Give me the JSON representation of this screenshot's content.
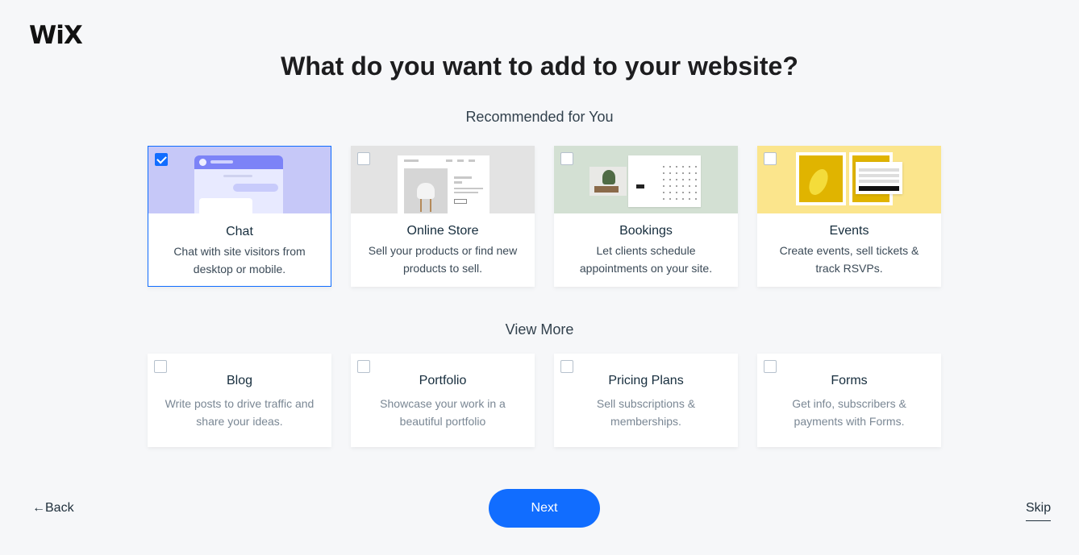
{
  "brand": {
    "logo_text": "WiX"
  },
  "title": "What do you want to add to your website?",
  "sections": {
    "recommended_label": "Recommended for You",
    "view_more_label": "View More"
  },
  "recommended": [
    {
      "title": "Chat",
      "description": "Chat with site visitors from desktop or mobile.",
      "checked": true
    },
    {
      "title": "Online Store",
      "description": "Sell your products or find new products to sell.",
      "checked": false
    },
    {
      "title": "Bookings",
      "description": "Let clients schedule appointments on your site.",
      "checked": false
    },
    {
      "title": "Events",
      "description": "Create events, sell tickets & track RSVPs.",
      "checked": false
    }
  ],
  "more": [
    {
      "title": "Blog",
      "description": "Write posts to drive traffic and share your ideas.",
      "checked": false
    },
    {
      "title": "Portfolio",
      "description": "Showcase your work in a beautiful portfolio",
      "checked": false
    },
    {
      "title": "Pricing Plans",
      "description": "Sell subscriptions & memberships.",
      "checked": false
    },
    {
      "title": "Forms",
      "description": "Get info, subscribers & payments with Forms.",
      "checked": false
    }
  ],
  "footer": {
    "back_label": "←Back",
    "next_label": "Next",
    "skip_label": "Skip"
  },
  "colors": {
    "accent": "#116dff",
    "background": "#f6f7f9"
  }
}
